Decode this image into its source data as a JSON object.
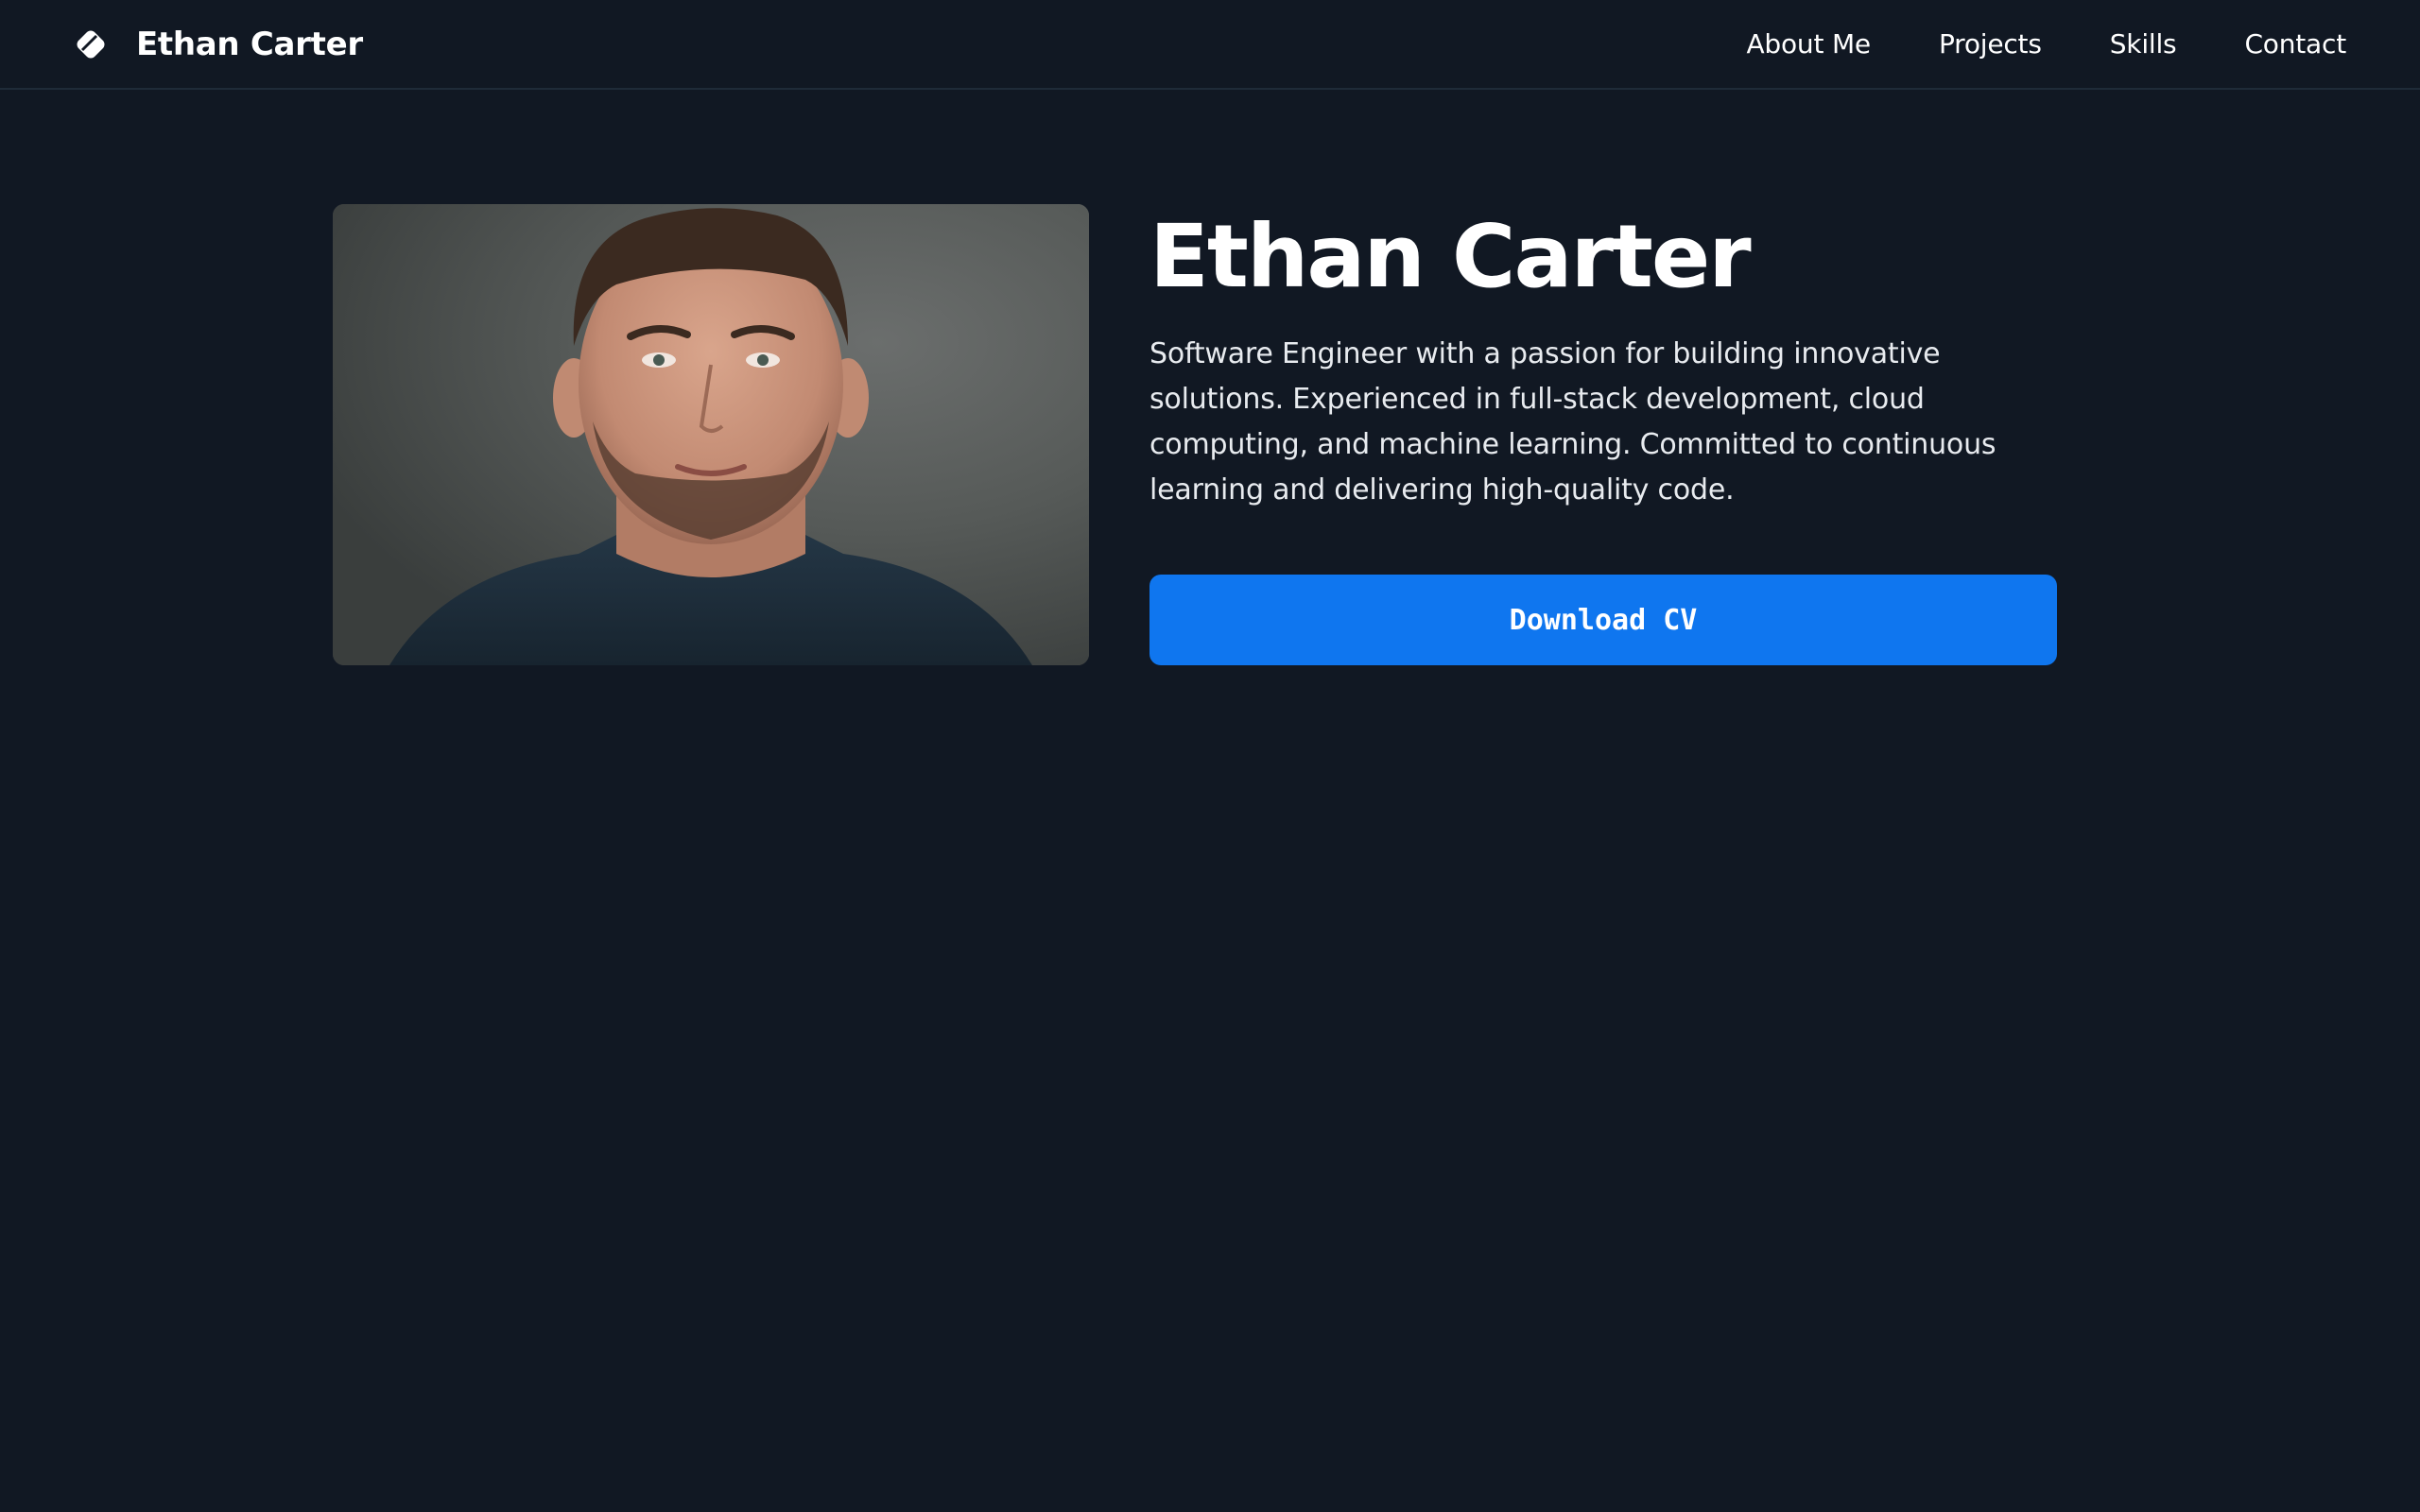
{
  "header": {
    "brand_name": "Ethan Carter",
    "brand_icon": "diamond-logo-icon",
    "nav": [
      {
        "label": "About Me"
      },
      {
        "label": "Projects"
      },
      {
        "label": "Skills"
      },
      {
        "label": "Contact"
      }
    ]
  },
  "hero": {
    "title": "Ethan Carter",
    "description": "Software Engineer with a passion for building innovative solutions. Experienced in full-stack development, cloud computing, and machine learning. Committed to continuous learning and delivering high-quality code.",
    "button_label": "Download CV"
  },
  "colors": {
    "background": "#111823",
    "accent": "#0f76ef",
    "text": "#ffffff",
    "divider": "#1f2b38"
  }
}
